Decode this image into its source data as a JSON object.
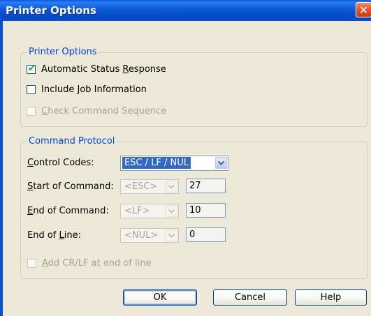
{
  "window": {
    "title": "Printer Options",
    "close_glyph": "✕"
  },
  "printer_options": {
    "legend": "Printer Options",
    "checkboxes": [
      {
        "pre": "Automatic Status ",
        "key": "R",
        "post": "esponse",
        "checked": true,
        "enabled": true
      },
      {
        "pre": "Include ",
        "key": "J",
        "post": "ob Information",
        "checked": false,
        "enabled": true
      },
      {
        "pre": "",
        "key": "C",
        "post": "heck Command Sequence",
        "checked": false,
        "enabled": false
      }
    ]
  },
  "command_protocol": {
    "legend": "Command Protocol",
    "control_codes": {
      "key": "C",
      "post": "ontrol Codes:",
      "value": "ESC / LF / NUL"
    },
    "start": {
      "key": "S",
      "post": "tart of Command:",
      "combo": "<ESC>",
      "field": "27"
    },
    "end": {
      "key": "E",
      "post": "nd of Command:",
      "combo": "<LF>",
      "field": "10"
    },
    "eol": {
      "pre": "End of ",
      "key": "L",
      "post": "ine:",
      "combo": "<NUL>",
      "field": "0"
    },
    "add_crlf": {
      "key": "A",
      "post": "dd CR/LF at end of line",
      "checked": false,
      "enabled": false
    }
  },
  "buttons": {
    "ok": "OK",
    "cancel": "Cancel",
    "help": "Help"
  }
}
